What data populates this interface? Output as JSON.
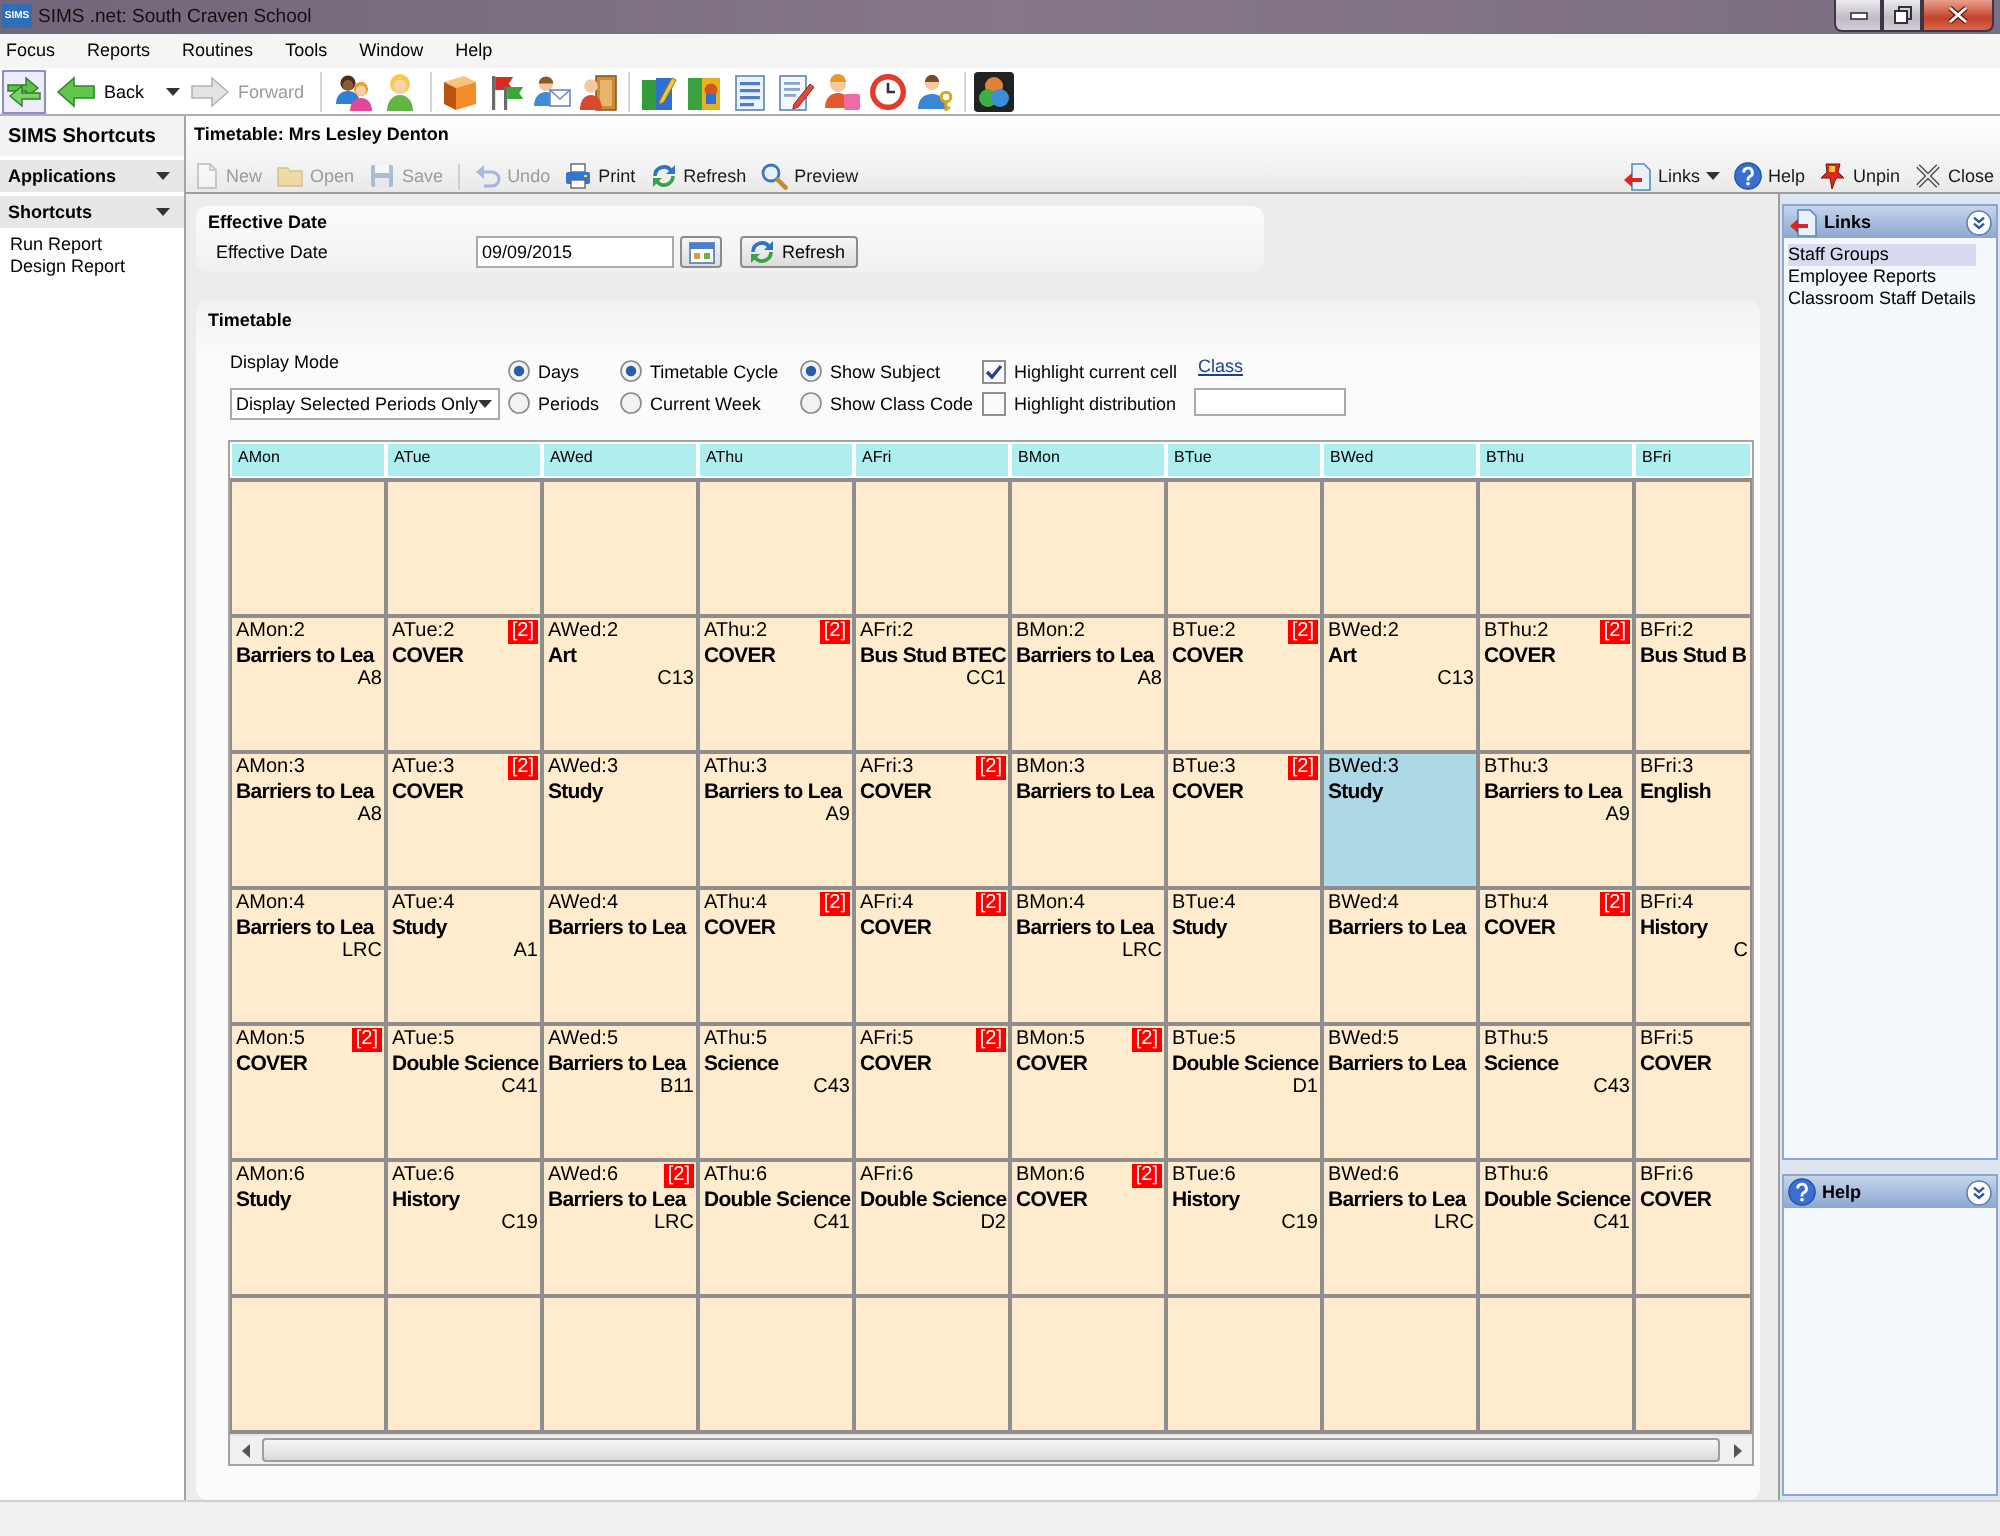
{
  "window": {
    "logo": "SIMS",
    "title": "SIMS .net: South Craven School"
  },
  "menu": [
    "Focus",
    "Reports",
    "Routines",
    "Tools",
    "Window",
    "Help"
  ],
  "toolbar": {
    "toggle_pressed": true,
    "back": {
      "label": "Back",
      "disabled": false
    },
    "forward": {
      "label": "Forward",
      "disabled": true
    }
  },
  "sidebar": {
    "title": "SIMS Shortcuts",
    "sections": [
      {
        "label": "Applications"
      },
      {
        "label": "Shortcuts",
        "items": [
          "Run Report",
          "Design Report"
        ]
      }
    ]
  },
  "page": {
    "title": "Timetable: Mrs Lesley Denton",
    "actions": [
      {
        "kind": "new",
        "label": "New",
        "disabled": true
      },
      {
        "kind": "open",
        "label": "Open",
        "disabled": true
      },
      {
        "kind": "save",
        "label": "Save",
        "disabled": true
      },
      {
        "kind": "undo",
        "label": "Undo",
        "disabled": true
      },
      {
        "kind": "print",
        "label": "Print",
        "disabled": false
      },
      {
        "kind": "refresh",
        "label": "Refresh",
        "disabled": false
      },
      {
        "kind": "preview",
        "label": "Preview",
        "disabled": false
      }
    ],
    "tools": [
      {
        "kind": "links",
        "label": "Links"
      },
      {
        "kind": "help",
        "label": "Help"
      },
      {
        "kind": "unpin",
        "label": "Unpin"
      },
      {
        "kind": "close",
        "label": "Close"
      }
    ]
  },
  "effective_date": {
    "title": "Effective Date",
    "label": "Effective Date",
    "value": "09/09/2015",
    "button": "Refresh"
  },
  "timetable": {
    "title": "Timetable",
    "display_mode": {
      "label": "Display Mode",
      "value": "Display Selected Periods Only"
    },
    "radio_groups": [
      [
        {
          "label": "Days",
          "selected": true
        },
        {
          "label": "Periods",
          "selected": false
        }
      ],
      [
        {
          "label": "Timetable Cycle",
          "selected": true
        },
        {
          "label": "Current Week",
          "selected": false
        }
      ],
      [
        {
          "label": "Show Subject",
          "selected": true
        },
        {
          "label": "Show Class Code",
          "selected": false
        }
      ]
    ],
    "checkboxes": [
      {
        "label": "Highlight current cell",
        "checked": true
      },
      {
        "label": "Highlight distribution",
        "checked": false
      }
    ],
    "class_link": "Class",
    "columns": [
      "AMon",
      "ATue",
      "AWed",
      "AThu",
      "AFri",
      "BMon",
      "BTue",
      "BWed",
      "BThu",
      "BFri"
    ],
    "rows": [
      [
        {
          "selected": false
        },
        {
          "selected": false
        },
        {
          "selected": false
        },
        {
          "selected": false
        },
        {
          "selected": false
        },
        {
          "selected": false
        },
        {
          "selected": false
        },
        {
          "selected": false
        },
        {
          "selected": false
        },
        {
          "selected": false
        }
      ],
      [
        {
          "period": "AMon:2",
          "subject": "Barriers to Lea",
          "room": "A8",
          "selected": false
        },
        {
          "period": "ATue:2",
          "subject": "COVER",
          "badge": "[2]",
          "selected": false
        },
        {
          "period": "AWed:2",
          "subject": "Art",
          "room": "C13",
          "selected": false
        },
        {
          "period": "AThu:2",
          "subject": "COVER",
          "badge": "[2]",
          "selected": false
        },
        {
          "period": "AFri:2",
          "subject": "Bus Stud BTEC",
          "room": "CC1",
          "selected": false
        },
        {
          "period": "BMon:2",
          "subject": "Barriers to Lea",
          "room": "A8",
          "selected": false
        },
        {
          "period": "BTue:2",
          "subject": "COVER",
          "badge": "[2]",
          "selected": false
        },
        {
          "period": "BWed:2",
          "subject": "Art",
          "room": "C13",
          "selected": false
        },
        {
          "period": "BThu:2",
          "subject": "COVER",
          "badge": "[2]",
          "selected": false
        },
        {
          "period": "BFri:2",
          "subject": "Bus Stud B",
          "selected": false
        }
      ],
      [
        {
          "period": "AMon:3",
          "subject": "Barriers to Lea",
          "room": "A8",
          "selected": false
        },
        {
          "period": "ATue:3",
          "subject": "COVER",
          "badge": "[2]",
          "selected": false
        },
        {
          "period": "AWed:3",
          "subject": "Study",
          "selected": false
        },
        {
          "period": "AThu:3",
          "subject": "Barriers to Lea",
          "room": "A9",
          "selected": false
        },
        {
          "period": "AFri:3",
          "subject": "COVER",
          "badge": "[2]",
          "selected": false
        },
        {
          "period": "BMon:3",
          "subject": "Barriers to Lea",
          "selected": false
        },
        {
          "period": "BTue:3",
          "subject": "COVER",
          "badge": "[2]",
          "selected": false
        },
        {
          "period": "BWed:3",
          "subject": "Study",
          "selected": true
        },
        {
          "period": "BThu:3",
          "subject": "Barriers to Lea",
          "room": "A9",
          "selected": false
        },
        {
          "period": "BFri:3",
          "subject": "English",
          "selected": false
        }
      ],
      [
        {
          "period": "AMon:4",
          "subject": "Barriers to Lea",
          "room": "LRC",
          "selected": false
        },
        {
          "period": "ATue:4",
          "subject": "Study",
          "room": "A1",
          "selected": false
        },
        {
          "period": "AWed:4",
          "subject": "Barriers to Lea",
          "selected": false
        },
        {
          "period": "AThu:4",
          "subject": "COVER",
          "badge": "[2]",
          "selected": false
        },
        {
          "period": "AFri:4",
          "subject": "COVER",
          "badge": "[2]",
          "selected": false
        },
        {
          "period": "BMon:4",
          "subject": "Barriers to Lea",
          "room": "LRC",
          "selected": false
        },
        {
          "period": "BTue:4",
          "subject": "Study",
          "selected": false
        },
        {
          "period": "BWed:4",
          "subject": "Barriers to Lea",
          "selected": false
        },
        {
          "period": "BThu:4",
          "subject": "COVER",
          "badge": "[2]",
          "selected": false
        },
        {
          "period": "BFri:4",
          "subject": "History",
          "room": "C",
          "selected": false
        }
      ],
      [
        {
          "period": "AMon:5",
          "subject": "COVER",
          "badge": "[2]",
          "selected": false
        },
        {
          "period": "ATue:5",
          "subject": "Double Science",
          "room": "C41",
          "selected": false
        },
        {
          "period": "AWed:5",
          "subject": "Barriers to Lea",
          "room": "B11",
          "selected": false
        },
        {
          "period": "AThu:5",
          "subject": "Science",
          "room": "C43",
          "selected": false
        },
        {
          "period": "AFri:5",
          "subject": "COVER",
          "badge": "[2]",
          "selected": false
        },
        {
          "period": "BMon:5",
          "subject": "COVER",
          "badge": "[2]",
          "selected": false
        },
        {
          "period": "BTue:5",
          "subject": "Double Science",
          "room": "D1",
          "selected": false
        },
        {
          "period": "BWed:5",
          "subject": "Barriers to Lea",
          "selected": false
        },
        {
          "period": "BThu:5",
          "subject": "Science",
          "room": "C43",
          "selected": false
        },
        {
          "period": "BFri:5",
          "subject": "COVER",
          "selected": false
        }
      ],
      [
        {
          "period": "AMon:6",
          "subject": "Study",
          "selected": false
        },
        {
          "period": "ATue:6",
          "subject": "History",
          "room": "C19",
          "selected": false
        },
        {
          "period": "AWed:6",
          "subject": "Barriers to Lea",
          "room": "LRC",
          "badge": "[2]",
          "selected": false
        },
        {
          "period": "AThu:6",
          "subject": "Double Science",
          "room": "C41",
          "selected": false
        },
        {
          "period": "AFri:6",
          "subject": "Double Science",
          "room": "D2",
          "selected": false
        },
        {
          "period": "BMon:6",
          "subject": "COVER",
          "badge": "[2]",
          "selected": false
        },
        {
          "period": "BTue:6",
          "subject": "History",
          "room": "C19",
          "selected": false
        },
        {
          "period": "BWed:6",
          "subject": "Barriers to Lea",
          "room": "LRC",
          "selected": false
        },
        {
          "period": "BThu:6",
          "subject": "Double Science",
          "room": "C41",
          "selected": false
        },
        {
          "period": "BFri:6",
          "subject": "COVER",
          "selected": false
        }
      ],
      [
        {
          "selected": false
        },
        {
          "selected": false
        },
        {
          "selected": false
        },
        {
          "selected": false
        },
        {
          "selected": false
        },
        {
          "selected": false
        },
        {
          "selected": false
        },
        {
          "selected": false
        },
        {
          "selected": false
        },
        {
          "selected": false
        }
      ]
    ]
  },
  "links_panel": {
    "title": "Links",
    "items": [
      {
        "label": "Staff Groups",
        "selected": true
      },
      {
        "label": "Employee Reports",
        "selected": false
      },
      {
        "label": "Classroom Staff Details",
        "selected": false
      }
    ]
  },
  "help_panel": {
    "title": "Help"
  }
}
